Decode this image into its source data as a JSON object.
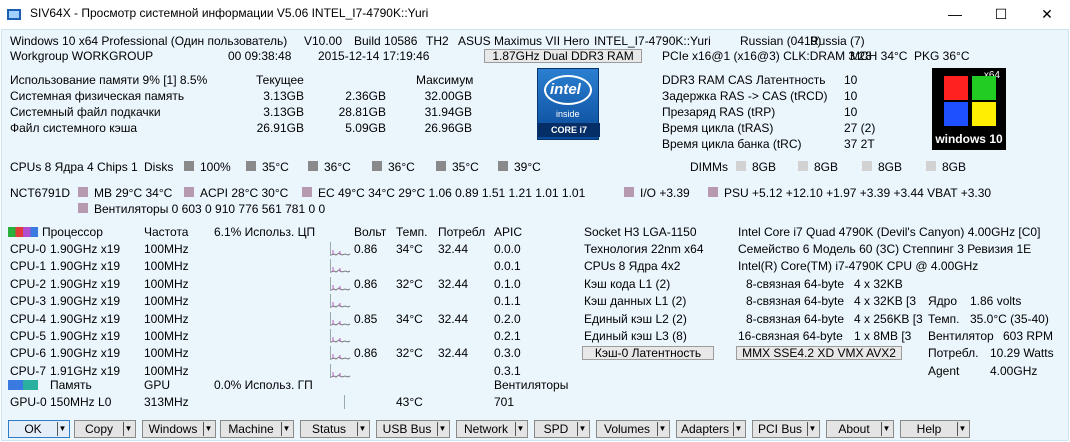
{
  "window": {
    "title": "SIV64X - Просмотр системной информации V5.06 INTEL_I7-4790K::Yuri",
    "minimize": "—",
    "maximize": "☐",
    "close": "✕"
  },
  "sysinfo": {
    "os": "Windows 10 x64 Professional (Один пользователь)",
    "version": "V10.00",
    "build": "Build 10586",
    "th": "TH2",
    "board": "ASUS Maximus VII Hero",
    "machine": "INTEL_I7-4790K::Yuri",
    "language": "Russian (0419)",
    "region": "Russia (7)",
    "workgroup": "Workgroup WORKGROUP",
    "uptime": "00 09:38:48",
    "datetime": "2015-12-14 17:19:46",
    "ram_button": "1.87GHz Dual DDR3 RAM",
    "pcie": "PCIe x16@1 (x16@3) CLK:DRAM 3:28",
    "mch": "MCH 34°C",
    "pkg": "PKG 36°C"
  },
  "memory": {
    "headers": {
      "usage": "Использование памяти 9% [1] 8.5%",
      "current": "Текущее",
      "max": "Максимум"
    },
    "rows": [
      {
        "label": "Системная физическая память",
        "v1": "3.13GB",
        "v2": "2.36GB",
        "v3": "32.00GB"
      },
      {
        "label": "Системный файл подкачки",
        "v1": "3.13GB",
        "v2": "28.81GB",
        "v3": "31.94GB"
      },
      {
        "label": "Файл системного кэша",
        "v1": "26.91GB",
        "v2": "5.09GB",
        "v3": "26.96GB"
      }
    ]
  },
  "intel_badge": {
    "brand": "intel",
    "inside": "inside",
    "core": "CORE i7"
  },
  "ddr": [
    {
      "label": "DDR3 RAM CAS Латентность",
      "value": "10"
    },
    {
      "label": "Задержка RAS -> CAS (tRCD)",
      "value": "10"
    },
    {
      "label": "Презаряд RAS (tRP)",
      "value": "10"
    },
    {
      "label": "Время цикла (tRAS)",
      "value": "27 (2)"
    },
    {
      "label": "Время цикла банка (tRC)",
      "value": "37 2T"
    }
  ],
  "win_badge": {
    "arch": "x64",
    "caption": "windows 10",
    "colors": [
      "#ff2020",
      "#22cc22",
      "#1e50ff",
      "#ffee00"
    ]
  },
  "cpus_line": {
    "label": "CPUs 8 Ядра 4 Chips 1",
    "disks": "Disks",
    "disk_pct": "100%",
    "temps": [
      "35°C",
      "36°C",
      "36°C",
      "35°C",
      "39°C"
    ],
    "dimms": "DIMMs",
    "dimm_sizes": [
      "8GB",
      "8GB",
      "8GB",
      "8GB"
    ]
  },
  "sensors": {
    "chip": "NCT6791D",
    "mb": "MB 29°C 34°C",
    "acpi": "ACPI 28°C 30°C",
    "ec": "EC 49°C 34°C 29°C 1.06 0.89 1.51 1.21 1.01 1.01",
    "io": "I/O +3.39",
    "psu": "PSU +5.12 +12.10 +1.97 +3.39 +3.44 VBAT +3.30",
    "fans": "Вентиляторы 0 603 0 910 776 561 781 0 0"
  },
  "cpu_table": {
    "headers": {
      "proc": "Процессор",
      "freq": "Частота",
      "usage": "6.1% Использ. ЦП",
      "volt": "Вольт",
      "temp": "Темп.",
      "power": "Потребл",
      "apic": "APIC"
    },
    "rows": [
      {
        "cpu": "CPU-0",
        "clk": "1.90GHz x19",
        "bus": "100MHz",
        "volt": "0.86",
        "temp": "34°C",
        "pow": "32.44",
        "apic": "0.0.0"
      },
      {
        "cpu": "CPU-1",
        "clk": "1.90GHz x19",
        "bus": "100MHz",
        "volt": "",
        "temp": "",
        "pow": "",
        "apic": "0.0.1"
      },
      {
        "cpu": "CPU-2",
        "clk": "1.90GHz x19",
        "bus": "100MHz",
        "volt": "0.86",
        "temp": "32°C",
        "pow": "32.44",
        "apic": "0.1.0"
      },
      {
        "cpu": "CPU-3",
        "clk": "1.90GHz x19",
        "bus": "100MHz",
        "volt": "",
        "temp": "",
        "pow": "",
        "apic": "0.1.1"
      },
      {
        "cpu": "CPU-4",
        "clk": "1.90GHz x19",
        "bus": "100MHz",
        "volt": "0.85",
        "temp": "34°C",
        "pow": "32.44",
        "apic": "0.2.0"
      },
      {
        "cpu": "CPU-5",
        "clk": "1.90GHz x19",
        "bus": "100MHz",
        "volt": "",
        "temp": "",
        "pow": "",
        "apic": "0.2.1"
      },
      {
        "cpu": "CPU-6",
        "clk": "1.90GHz x19",
        "bus": "100MHz",
        "volt": "0.86",
        "temp": "32°C",
        "pow": "32.44",
        "apic": "0.3.0"
      },
      {
        "cpu": "CPU-7",
        "clk": "1.91GHz x19",
        "bus": "100MHz",
        "volt": "",
        "temp": "",
        "pow": "",
        "apic": "0.3.1"
      }
    ]
  },
  "gpu_table": {
    "headers": {
      "mem": "Память",
      "gpu": "GPU",
      "usage": "0.0% Использ. ГП",
      "fans": "Вентиляторы"
    },
    "row": {
      "gpu": "GPU-0",
      "mem": "150MHz L0",
      "clk": "313MHz",
      "temp": "43°C",
      "fan": "701"
    }
  },
  "cpu_info_left": [
    {
      "label": "Socket H3 LGA-1150"
    },
    {
      "label": "Технология 22nm  x64"
    },
    {
      "label": "CPUs 8 Ядра 4x2"
    },
    {
      "label": "Кэш кода L1 (2)"
    },
    {
      "label": "Кэш данных L1 (2)"
    },
    {
      "label": "Единый кэш L2 (2)"
    },
    {
      "label": "Единый кэш L3 (8)"
    }
  ],
  "cache_btn": "Кэш-0 Латентность",
  "cpu_info_right": {
    "name": "Intel Core i7 Quad 4790K (Devil's Canyon) 4.00GHz [C0]",
    "family": "Семейство 6  Модель 60 (3C)  Степпинг 3  Ревизия 1E",
    "brand": "Intel(R) Core(TM) i7-4790K CPU @ 4.00GHz",
    "caches": [
      {
        "assoc": "8-связная 64-byte",
        "size": "4 x 32KB"
      },
      {
        "assoc": "8-связная 64-byte",
        "size": "4 x 32KB [3"
      },
      {
        "assoc": "8-связная 64-byte",
        "size": "4 x 256KB [3"
      },
      {
        "assoc": "16-связная 64-byte",
        "size": "1 x 8MB  [3"
      }
    ],
    "features_btn": "MMX SSE4.2 XD VMX AVX2",
    "stats": [
      {
        "label": "Ядро",
        "value": "1.86 volts"
      },
      {
        "label": "Темп.",
        "value": "35.0°C (35-40)"
      },
      {
        "label": "Вентилятор",
        "value": "603 RPM"
      },
      {
        "label": "Потребл.",
        "value": "10.29 Watts"
      },
      {
        "label": "Agent",
        "value": "4.00GHz"
      }
    ]
  },
  "buttons": [
    "OK",
    "Copy",
    "Windows",
    "Machine",
    "Status",
    "USB Bus",
    "Network",
    "SPD",
    "Volumes",
    "Adapters",
    "PCI Bus",
    "About",
    "Help"
  ]
}
